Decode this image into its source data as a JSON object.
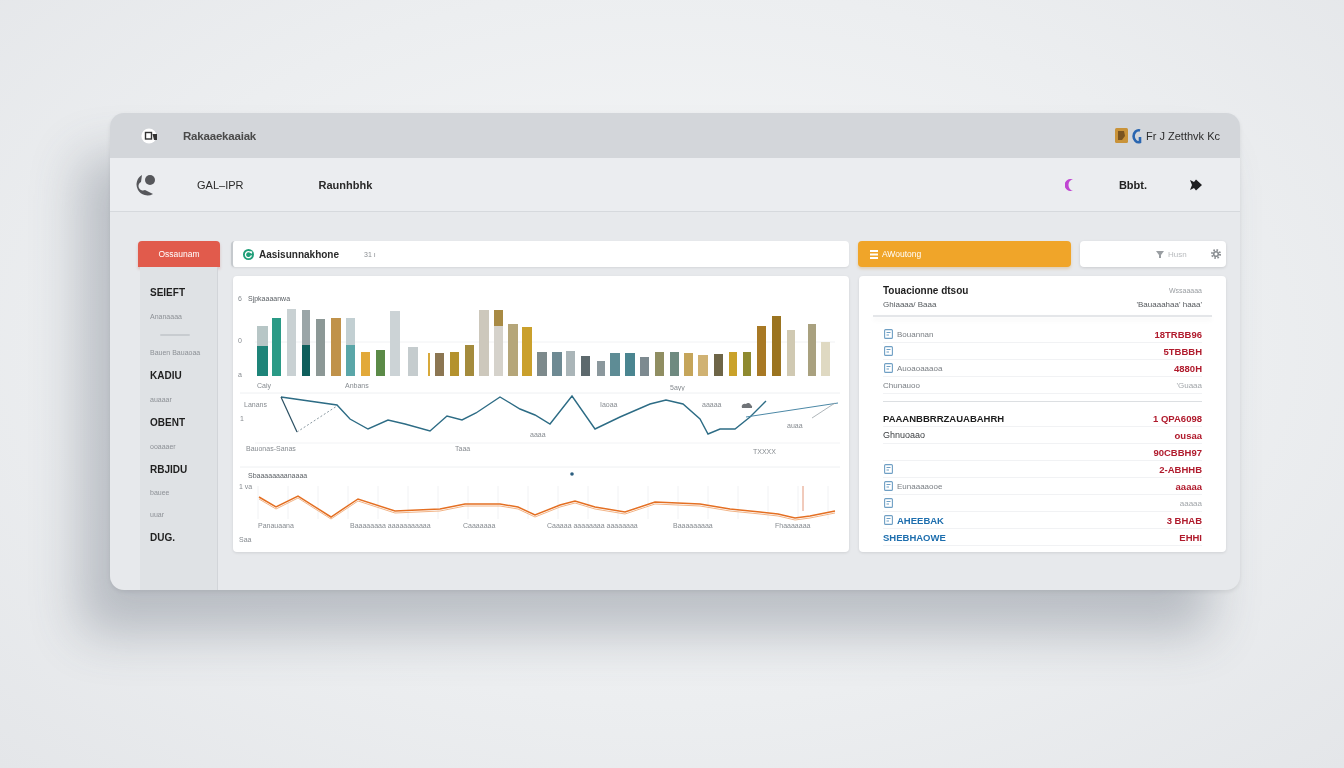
{
  "window": {
    "title": "Rakaaekaaiak",
    "badge_text": "Fr J Zetthvk Kc"
  },
  "navbar": {
    "brand": "GAL–IPR",
    "link": "Raunhbhk",
    "account": "Bbbt."
  },
  "sidebar": {
    "button": "Ossaunam",
    "items": [
      {
        "kind": "heading",
        "label": "SEIEFT"
      },
      {
        "kind": "caption",
        "label": "Ananaaaa"
      },
      {
        "kind": "divider"
      },
      {
        "kind": "caption",
        "label": "Bauen Bauaoaa"
      },
      {
        "kind": "heading",
        "label": "KADIU"
      },
      {
        "kind": "caption",
        "label": "auaaar"
      },
      {
        "kind": "heading",
        "label": "OBENT"
      },
      {
        "kind": "caption",
        "label": "ooaaaer"
      },
      {
        "kind": "heading",
        "label": "RBJIDU"
      },
      {
        "kind": "caption",
        "label": "bauee"
      },
      {
        "kind": "caption",
        "label": "uuar"
      },
      {
        "kind": "heading",
        "label": "DUG."
      }
    ]
  },
  "chart_panel": {
    "header": {
      "title": "Aasisunnakhone",
      "count": "31 ı"
    },
    "bar_chart": {
      "title": "Sjpkaaaanwa",
      "ticks": [
        "6",
        "0",
        "a"
      ],
      "labels": [
        "Caiy",
        "Anbans",
        "5ayy"
      ]
    },
    "line_chart": {
      "ticks": [
        "1"
      ],
      "labels": [
        "Lanans",
        "Iaoaa",
        "aaaaa",
        "Bauonas-Sanas",
        "Taaa",
        "TXXXX",
        "auaa",
        "aaaa"
      ]
    },
    "trend_chart": {
      "title": "Sbaaaaaaaanaaaa",
      "ticks": [
        "1 va",
        "Saa"
      ],
      "labels": [
        "Panauaana",
        "Baaaaaaaa aaaaaaaaaaa",
        "Caaaaaaa",
        "Caaaaa aaaaaaaa aaaaaaaa",
        "Baaaaaaaaa",
        "Fhaaaaaaa"
      ]
    }
  },
  "right_panel": {
    "action_button": "AWoutong",
    "search": {
      "placeholder": "Husn"
    },
    "summary": {
      "title": "Touacionne dtsou",
      "meta": "Wssaaaaa",
      "subtitle": "Ghiaaaa/ Baaa",
      "meta_sub": "'Bauaaahaa' haaa'",
      "rows": [
        {
          "kind": "item",
          "icon": true,
          "label": "Bouannan",
          "value": "18TRBB96",
          "muted": false
        },
        {
          "kind": "item",
          "icon": true,
          "value": "5TBBBH",
          "muted": false
        },
        {
          "kind": "item",
          "icon": true,
          "label": "Auoaoaaaoa",
          "value": "4880H",
          "muted": false
        },
        {
          "kind": "item",
          "icon": false,
          "label": "Chunauoo",
          "value": "'Guaaa",
          "muted": true
        },
        {
          "kind": "divider"
        },
        {
          "kind": "heading",
          "icon": false,
          "label": "PAAANBBRRZAUABAHRH",
          "value": "1 QPA6098",
          "muted": false
        },
        {
          "kind": "plain",
          "icon": false,
          "label": "Ghnuoaao",
          "value": "ousaa",
          "muted": false
        },
        {
          "kind": "item",
          "icon": false,
          "value": "90CBBH97",
          "muted": false
        },
        {
          "kind": "item",
          "icon": true,
          "value": "2-ABHHB",
          "muted": false
        },
        {
          "kind": "item",
          "icon": true,
          "label": "Eunaaaaooe",
          "value": "aaaaa",
          "muted": false
        },
        {
          "kind": "item",
          "icon": true,
          "value": "aaaaa",
          "muted": true
        },
        {
          "kind": "link",
          "icon": true,
          "label": "AHEEBAK",
          "value": "3 BHAB",
          "muted": false
        },
        {
          "kind": "link",
          "icon": false,
          "label": "SHEBHAOWE",
          "value": "EHHI",
          "muted": false
        }
      ]
    }
  }
}
